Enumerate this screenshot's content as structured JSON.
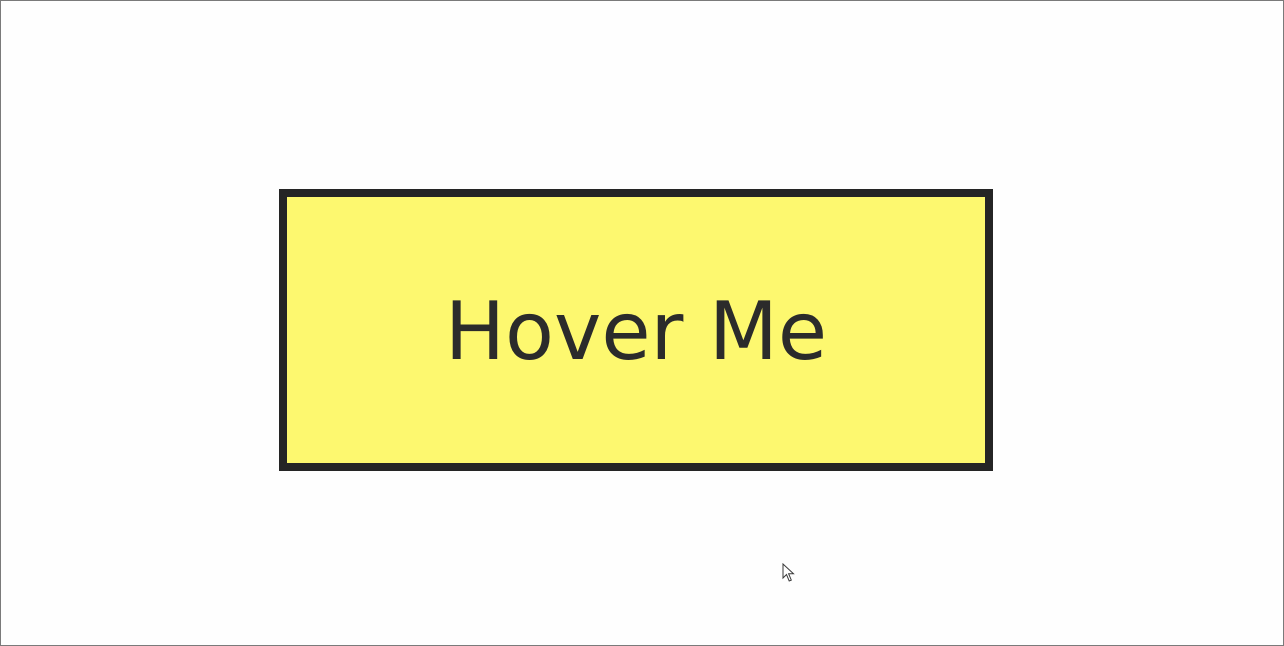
{
  "hover_box": {
    "label": "Hover Me",
    "background_color": "#fdf86f",
    "border_color": "#252525",
    "text_color": "#2b2b2b"
  },
  "cursor": {
    "icon": "arrow-pointer-icon"
  }
}
